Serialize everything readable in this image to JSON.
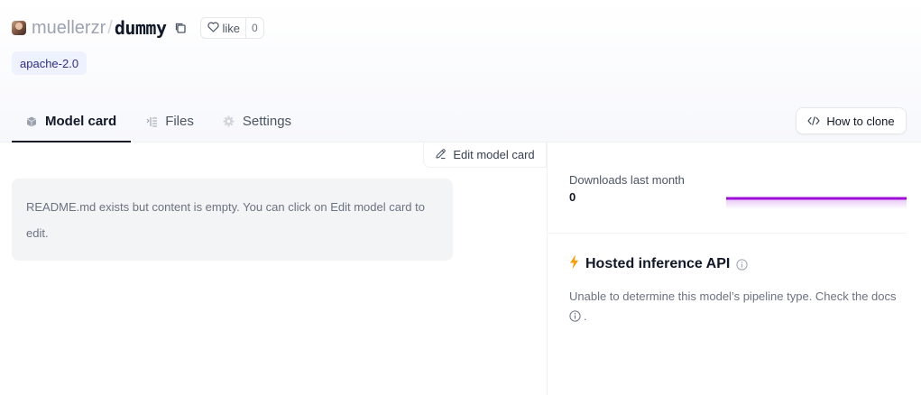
{
  "header": {
    "owner": "muellerzr",
    "separator": "/",
    "repo": "dummy",
    "like_label": "like",
    "like_count": "0"
  },
  "tags": [
    "apache-2.0"
  ],
  "tabs": [
    {
      "label": "Model card",
      "icon": "cube-icon",
      "active": true
    },
    {
      "label": "Files",
      "icon": "files-icon",
      "active": false
    },
    {
      "label": "Settings",
      "icon": "gear-icon",
      "active": false
    }
  ],
  "clone_button": {
    "label": "How to clone",
    "icon": "code-icon"
  },
  "edit_button": {
    "label": "Edit model card",
    "icon": "pencil-icon"
  },
  "readme": {
    "message": "README.md exists but content is empty. You can click on Edit model card to edit."
  },
  "downloads": {
    "label": "Downloads last month",
    "value": "0"
  },
  "inference": {
    "title": "Hosted inference API",
    "message": "Unable to determine this model’s pipeline type. Check the docs",
    "suffix": "."
  },
  "colors": {
    "accent": "#9e0cd8",
    "tag_bg": "#eef2ff",
    "bolt": "#f59e0b"
  }
}
